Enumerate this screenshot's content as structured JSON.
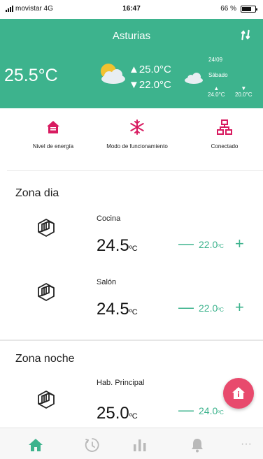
{
  "status_bar": {
    "carrier": "movistar  4G",
    "time": "16:47",
    "battery": "66 %"
  },
  "header": {
    "city": "Asturias",
    "current_temp": "25.5°C",
    "today_high": "▲25.0°C",
    "today_low": "▼22.0°C",
    "forecast_date": "24/09",
    "forecast_day": "Sábado",
    "forecast_high": "24.0°C",
    "forecast_low": "20.0°C",
    "accent_color": "#3db38d"
  },
  "actions": {
    "energy_label": "Nivel de energía",
    "mode_label": "Modo de funcionamiento",
    "connected_label": "Conectado",
    "icon_color": "#d81b60"
  },
  "zones": [
    {
      "title": "Zona dia",
      "rooms": [
        {
          "name": "Cocina",
          "temp": "24.5",
          "unit": "ºC",
          "setpoint": "22.0",
          "set_unit": "ºC"
        },
        {
          "name": "Salón",
          "temp": "24.5",
          "unit": "ºC",
          "setpoint": "22.0",
          "set_unit": "ºC"
        }
      ]
    },
    {
      "title": "Zona noche",
      "rooms": [
        {
          "name": "Hab. Principal",
          "temp": "25.0",
          "unit": "ºC",
          "setpoint": "24.0",
          "set_unit": "ºC"
        }
      ]
    }
  ],
  "controls": {
    "minus": "—",
    "plus": "+"
  },
  "nav": {
    "items": [
      "home-icon",
      "clock-icon",
      "stats-icon",
      "bell-icon",
      "more-icon"
    ],
    "more_label": "···"
  }
}
